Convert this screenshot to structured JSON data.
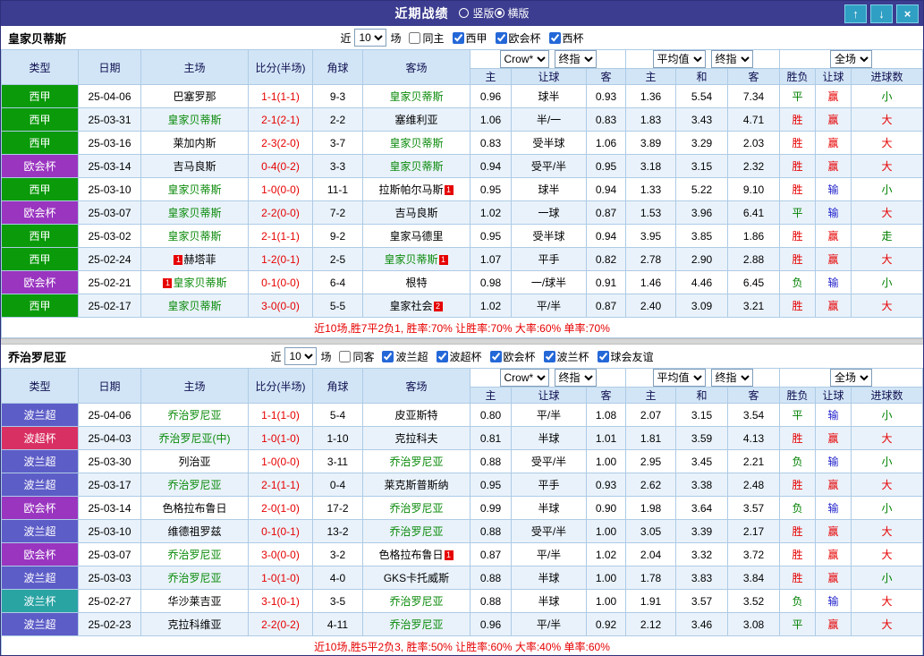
{
  "titlebar": {
    "title": "近期战绩",
    "radios": [
      {
        "label": "竖版",
        "selected": false
      },
      {
        "label": "横版",
        "selected": true
      }
    ],
    "buttons": {
      "up": "↑",
      "down": "↓",
      "close": "×"
    }
  },
  "colors": {
    "league": {
      "西甲": "#0a9a0a",
      "欧会杯": "#9a35c0",
      "波兰超": "#5d5dc8",
      "波超杯": "#d93064",
      "波兰杯": "#2aa3a3"
    },
    "result": {
      "胜": "#e60000",
      "平": "#008000",
      "负": "#008000",
      "赢": "#e60000",
      "输": "#2222cc",
      "大": "#e60000",
      "小": "#008000",
      "走": "#008000"
    }
  },
  "table": {
    "left_columns": [
      "类型",
      "日期",
      "主场",
      "比分(半场)",
      "角球",
      "客场"
    ],
    "sub_columns": [
      "主",
      "让球",
      "客",
      "主",
      "和",
      "客",
      "胜负",
      "让球",
      "进球数"
    ]
  },
  "sections": [
    {
      "team": "皇家贝蒂斯",
      "near_label": "近",
      "count": "10",
      "games_label": "场",
      "filters": [
        {
          "label": "同主",
          "checked": false
        },
        {
          "label": "西甲",
          "checked": true
        },
        {
          "label": "欧会杯",
          "checked": true
        },
        {
          "label": "西杯",
          "checked": true
        }
      ],
      "dropdown_groups": [
        [
          "Crow*",
          "终指"
        ],
        [
          "平均值",
          "终指"
        ],
        [
          "全场"
        ]
      ],
      "rows": [
        {
          "league": "西甲",
          "date": "25-04-06",
          "home": {
            "name": "巴塞罗那"
          },
          "score": "1-1(1-1)",
          "corner": "9-3",
          "away": {
            "name": "皇家贝蒂斯",
            "focus": true
          },
          "odds": [
            "0.96",
            "球半",
            "0.93"
          ],
          "euro": [
            "1.36",
            "5.54",
            "7.34"
          ],
          "results": [
            "平",
            "赢",
            "小"
          ]
        },
        {
          "league": "西甲",
          "date": "25-03-31",
          "home": {
            "name": "皇家贝蒂斯",
            "focus": true
          },
          "score": "2-1(2-1)",
          "corner": "2-2",
          "away": {
            "name": "塞维利亚"
          },
          "odds": [
            "1.06",
            "半/一",
            "0.83"
          ],
          "euro": [
            "1.83",
            "3.43",
            "4.71"
          ],
          "results": [
            "胜",
            "赢",
            "大"
          ]
        },
        {
          "league": "西甲",
          "date": "25-03-16",
          "home": {
            "name": "莱加内斯"
          },
          "score": "2-3(2-0)",
          "corner": "3-7",
          "away": {
            "name": "皇家贝蒂斯",
            "focus": true
          },
          "odds": [
            "0.83",
            "受半球",
            "1.06"
          ],
          "euro": [
            "3.89",
            "3.29",
            "2.03"
          ],
          "results": [
            "胜",
            "赢",
            "大"
          ]
        },
        {
          "league": "欧会杯",
          "date": "25-03-14",
          "home": {
            "name": "吉马良斯"
          },
          "score": "0-4(0-2)",
          "corner": "3-3",
          "away": {
            "name": "皇家贝蒂斯",
            "focus": true
          },
          "odds": [
            "0.94",
            "受平/半",
            "0.95"
          ],
          "euro": [
            "3.18",
            "3.15",
            "2.32"
          ],
          "results": [
            "胜",
            "赢",
            "大"
          ]
        },
        {
          "league": "西甲",
          "date": "25-03-10",
          "home": {
            "name": "皇家贝蒂斯",
            "focus": true
          },
          "score": "1-0(0-0)",
          "corner": "11-1",
          "away": {
            "name": "拉斯帕尔马斯",
            "card_post": "1"
          },
          "odds": [
            "0.95",
            "球半",
            "0.94"
          ],
          "euro": [
            "1.33",
            "5.22",
            "9.10"
          ],
          "results": [
            "胜",
            "输",
            "小"
          ]
        },
        {
          "league": "欧会杯",
          "date": "25-03-07",
          "home": {
            "name": "皇家贝蒂斯",
            "focus": true
          },
          "score": "2-2(0-0)",
          "corner": "7-2",
          "away": {
            "name": "吉马良斯"
          },
          "odds": [
            "1.02",
            "一球",
            "0.87"
          ],
          "euro": [
            "1.53",
            "3.96",
            "6.41"
          ],
          "results": [
            "平",
            "输",
            "大"
          ]
        },
        {
          "league": "西甲",
          "date": "25-03-02",
          "home": {
            "name": "皇家贝蒂斯",
            "focus": true
          },
          "score": "2-1(1-1)",
          "corner": "9-2",
          "away": {
            "name": "皇家马德里"
          },
          "odds": [
            "0.95",
            "受半球",
            "0.94"
          ],
          "euro": [
            "3.95",
            "3.85",
            "1.86"
          ],
          "results": [
            "胜",
            "赢",
            "走"
          ]
        },
        {
          "league": "西甲",
          "date": "25-02-24",
          "home": {
            "name": "赫塔菲",
            "card_pre": "1"
          },
          "score": "1-2(0-1)",
          "corner": "2-5",
          "away": {
            "name": "皇家贝蒂斯",
            "focus": true,
            "card_post": "1"
          },
          "odds": [
            "1.07",
            "平手",
            "0.82"
          ],
          "euro": [
            "2.78",
            "2.90",
            "2.88"
          ],
          "results": [
            "胜",
            "赢",
            "大"
          ]
        },
        {
          "league": "欧会杯",
          "date": "25-02-21",
          "home": {
            "name": "皇家贝蒂斯",
            "focus": true,
            "card_pre": "1"
          },
          "score": "0-1(0-0)",
          "corner": "6-4",
          "away": {
            "name": "根特"
          },
          "odds": [
            "0.98",
            "一/球半",
            "0.91"
          ],
          "euro": [
            "1.46",
            "4.46",
            "6.45"
          ],
          "results": [
            "负",
            "输",
            "小"
          ]
        },
        {
          "league": "西甲",
          "date": "25-02-17",
          "home": {
            "name": "皇家贝蒂斯",
            "focus": true
          },
          "score": "3-0(0-0)",
          "corner": "5-5",
          "away": {
            "name": "皇家社会",
            "card_post": "2"
          },
          "odds": [
            "1.02",
            "平/半",
            "0.87"
          ],
          "euro": [
            "2.40",
            "3.09",
            "3.21"
          ],
          "results": [
            "胜",
            "赢",
            "大"
          ]
        }
      ],
      "summary": "近10场,胜7平2负1, 胜率:70% 让胜率:70% 大率:60% 单率:70%"
    },
    {
      "team": "乔治罗尼亚",
      "near_label": "近",
      "count": "10",
      "games_label": "场",
      "filters": [
        {
          "label": "同客",
          "checked": false
        },
        {
          "label": "波兰超",
          "checked": true
        },
        {
          "label": "波超杯",
          "checked": true
        },
        {
          "label": "欧会杯",
          "checked": true
        },
        {
          "label": "波兰杯",
          "checked": true
        },
        {
          "label": "球会友谊",
          "checked": true
        }
      ],
      "dropdown_groups": [
        [
          "Crow*",
          "终指"
        ],
        [
          "平均值",
          "终指"
        ],
        [
          "全场"
        ]
      ],
      "rows": [
        {
          "league": "波兰超",
          "date": "25-04-06",
          "home": {
            "name": "乔治罗尼亚",
            "focus": true
          },
          "score": "1-1(1-0)",
          "corner": "5-4",
          "away": {
            "name": "皮亚斯特"
          },
          "odds": [
            "0.80",
            "平/半",
            "1.08"
          ],
          "euro": [
            "2.07",
            "3.15",
            "3.54"
          ],
          "results": [
            "平",
            "输",
            "小"
          ]
        },
        {
          "league": "波超杯",
          "date": "25-04-03",
          "home": {
            "name": "乔治罗尼亚(中)",
            "focus": true
          },
          "score": "1-0(1-0)",
          "corner": "1-10",
          "away": {
            "name": "克拉科夫"
          },
          "odds": [
            "0.81",
            "半球",
            "1.01"
          ],
          "euro": [
            "1.81",
            "3.59",
            "4.13"
          ],
          "results": [
            "胜",
            "赢",
            "大"
          ]
        },
        {
          "league": "波兰超",
          "date": "25-03-30",
          "home": {
            "name": "列治亚"
          },
          "score": "1-0(0-0)",
          "corner": "3-11",
          "away": {
            "name": "乔治罗尼亚",
            "focus": true
          },
          "odds": [
            "0.88",
            "受平/半",
            "1.00"
          ],
          "euro": [
            "2.95",
            "3.45",
            "2.21"
          ],
          "results": [
            "负",
            "输",
            "小"
          ]
        },
        {
          "league": "波兰超",
          "date": "25-03-17",
          "home": {
            "name": "乔治罗尼亚",
            "focus": true
          },
          "score": "2-1(1-1)",
          "corner": "0-4",
          "away": {
            "name": "莱克斯普斯纳"
          },
          "odds": [
            "0.95",
            "平手",
            "0.93"
          ],
          "euro": [
            "2.62",
            "3.38",
            "2.48"
          ],
          "results": [
            "胜",
            "赢",
            "大"
          ]
        },
        {
          "league": "欧会杯",
          "date": "25-03-14",
          "home": {
            "name": "色格拉布鲁日"
          },
          "score": "2-0(1-0)",
          "corner": "17-2",
          "away": {
            "name": "乔治罗尼亚",
            "focus": true
          },
          "odds": [
            "0.99",
            "半球",
            "0.90"
          ],
          "euro": [
            "1.98",
            "3.64",
            "3.57"
          ],
          "results": [
            "负",
            "输",
            "小"
          ]
        },
        {
          "league": "波兰超",
          "date": "25-03-10",
          "home": {
            "name": "维德祖罗兹"
          },
          "score": "0-1(0-1)",
          "corner": "13-2",
          "away": {
            "name": "乔治罗尼亚",
            "focus": true
          },
          "odds": [
            "0.88",
            "受平/半",
            "1.00"
          ],
          "euro": [
            "3.05",
            "3.39",
            "2.17"
          ],
          "results": [
            "胜",
            "赢",
            "大"
          ]
        },
        {
          "league": "欧会杯",
          "date": "25-03-07",
          "home": {
            "name": "乔治罗尼亚",
            "focus": true
          },
          "score": "3-0(0-0)",
          "corner": "3-2",
          "away": {
            "name": "色格拉布鲁日",
            "card_post": "1"
          },
          "odds": [
            "0.87",
            "平/半",
            "1.02"
          ],
          "euro": [
            "2.04",
            "3.32",
            "3.72"
          ],
          "results": [
            "胜",
            "赢",
            "大"
          ]
        },
        {
          "league": "波兰超",
          "date": "25-03-03",
          "home": {
            "name": "乔治罗尼亚",
            "focus": true
          },
          "score": "1-0(1-0)",
          "corner": "4-0",
          "away": {
            "name": "GKS卡托威斯"
          },
          "odds": [
            "0.88",
            "半球",
            "1.00"
          ],
          "euro": [
            "1.78",
            "3.83",
            "3.84"
          ],
          "results": [
            "胜",
            "赢",
            "小"
          ]
        },
        {
          "league": "波兰杯",
          "date": "25-02-27",
          "home": {
            "name": "华沙莱吉亚"
          },
          "score": "3-1(0-1)",
          "corner": "3-5",
          "away": {
            "name": "乔治罗尼亚",
            "focus": true
          },
          "odds": [
            "0.88",
            "半球",
            "1.00"
          ],
          "euro": [
            "1.91",
            "3.57",
            "3.52"
          ],
          "results": [
            "负",
            "输",
            "大"
          ]
        },
        {
          "league": "波兰超",
          "date": "25-02-23",
          "home": {
            "name": "克拉科维亚"
          },
          "score": "2-2(0-2)",
          "corner": "4-11",
          "away": {
            "name": "乔治罗尼亚",
            "focus": true
          },
          "odds": [
            "0.96",
            "平/半",
            "0.92"
          ],
          "euro": [
            "2.12",
            "3.46",
            "3.08"
          ],
          "results": [
            "平",
            "赢",
            "大"
          ]
        }
      ],
      "summary": "近10场,胜5平2负3, 胜率:50% 让胜率:60% 大率:40% 单率:60%"
    }
  ]
}
